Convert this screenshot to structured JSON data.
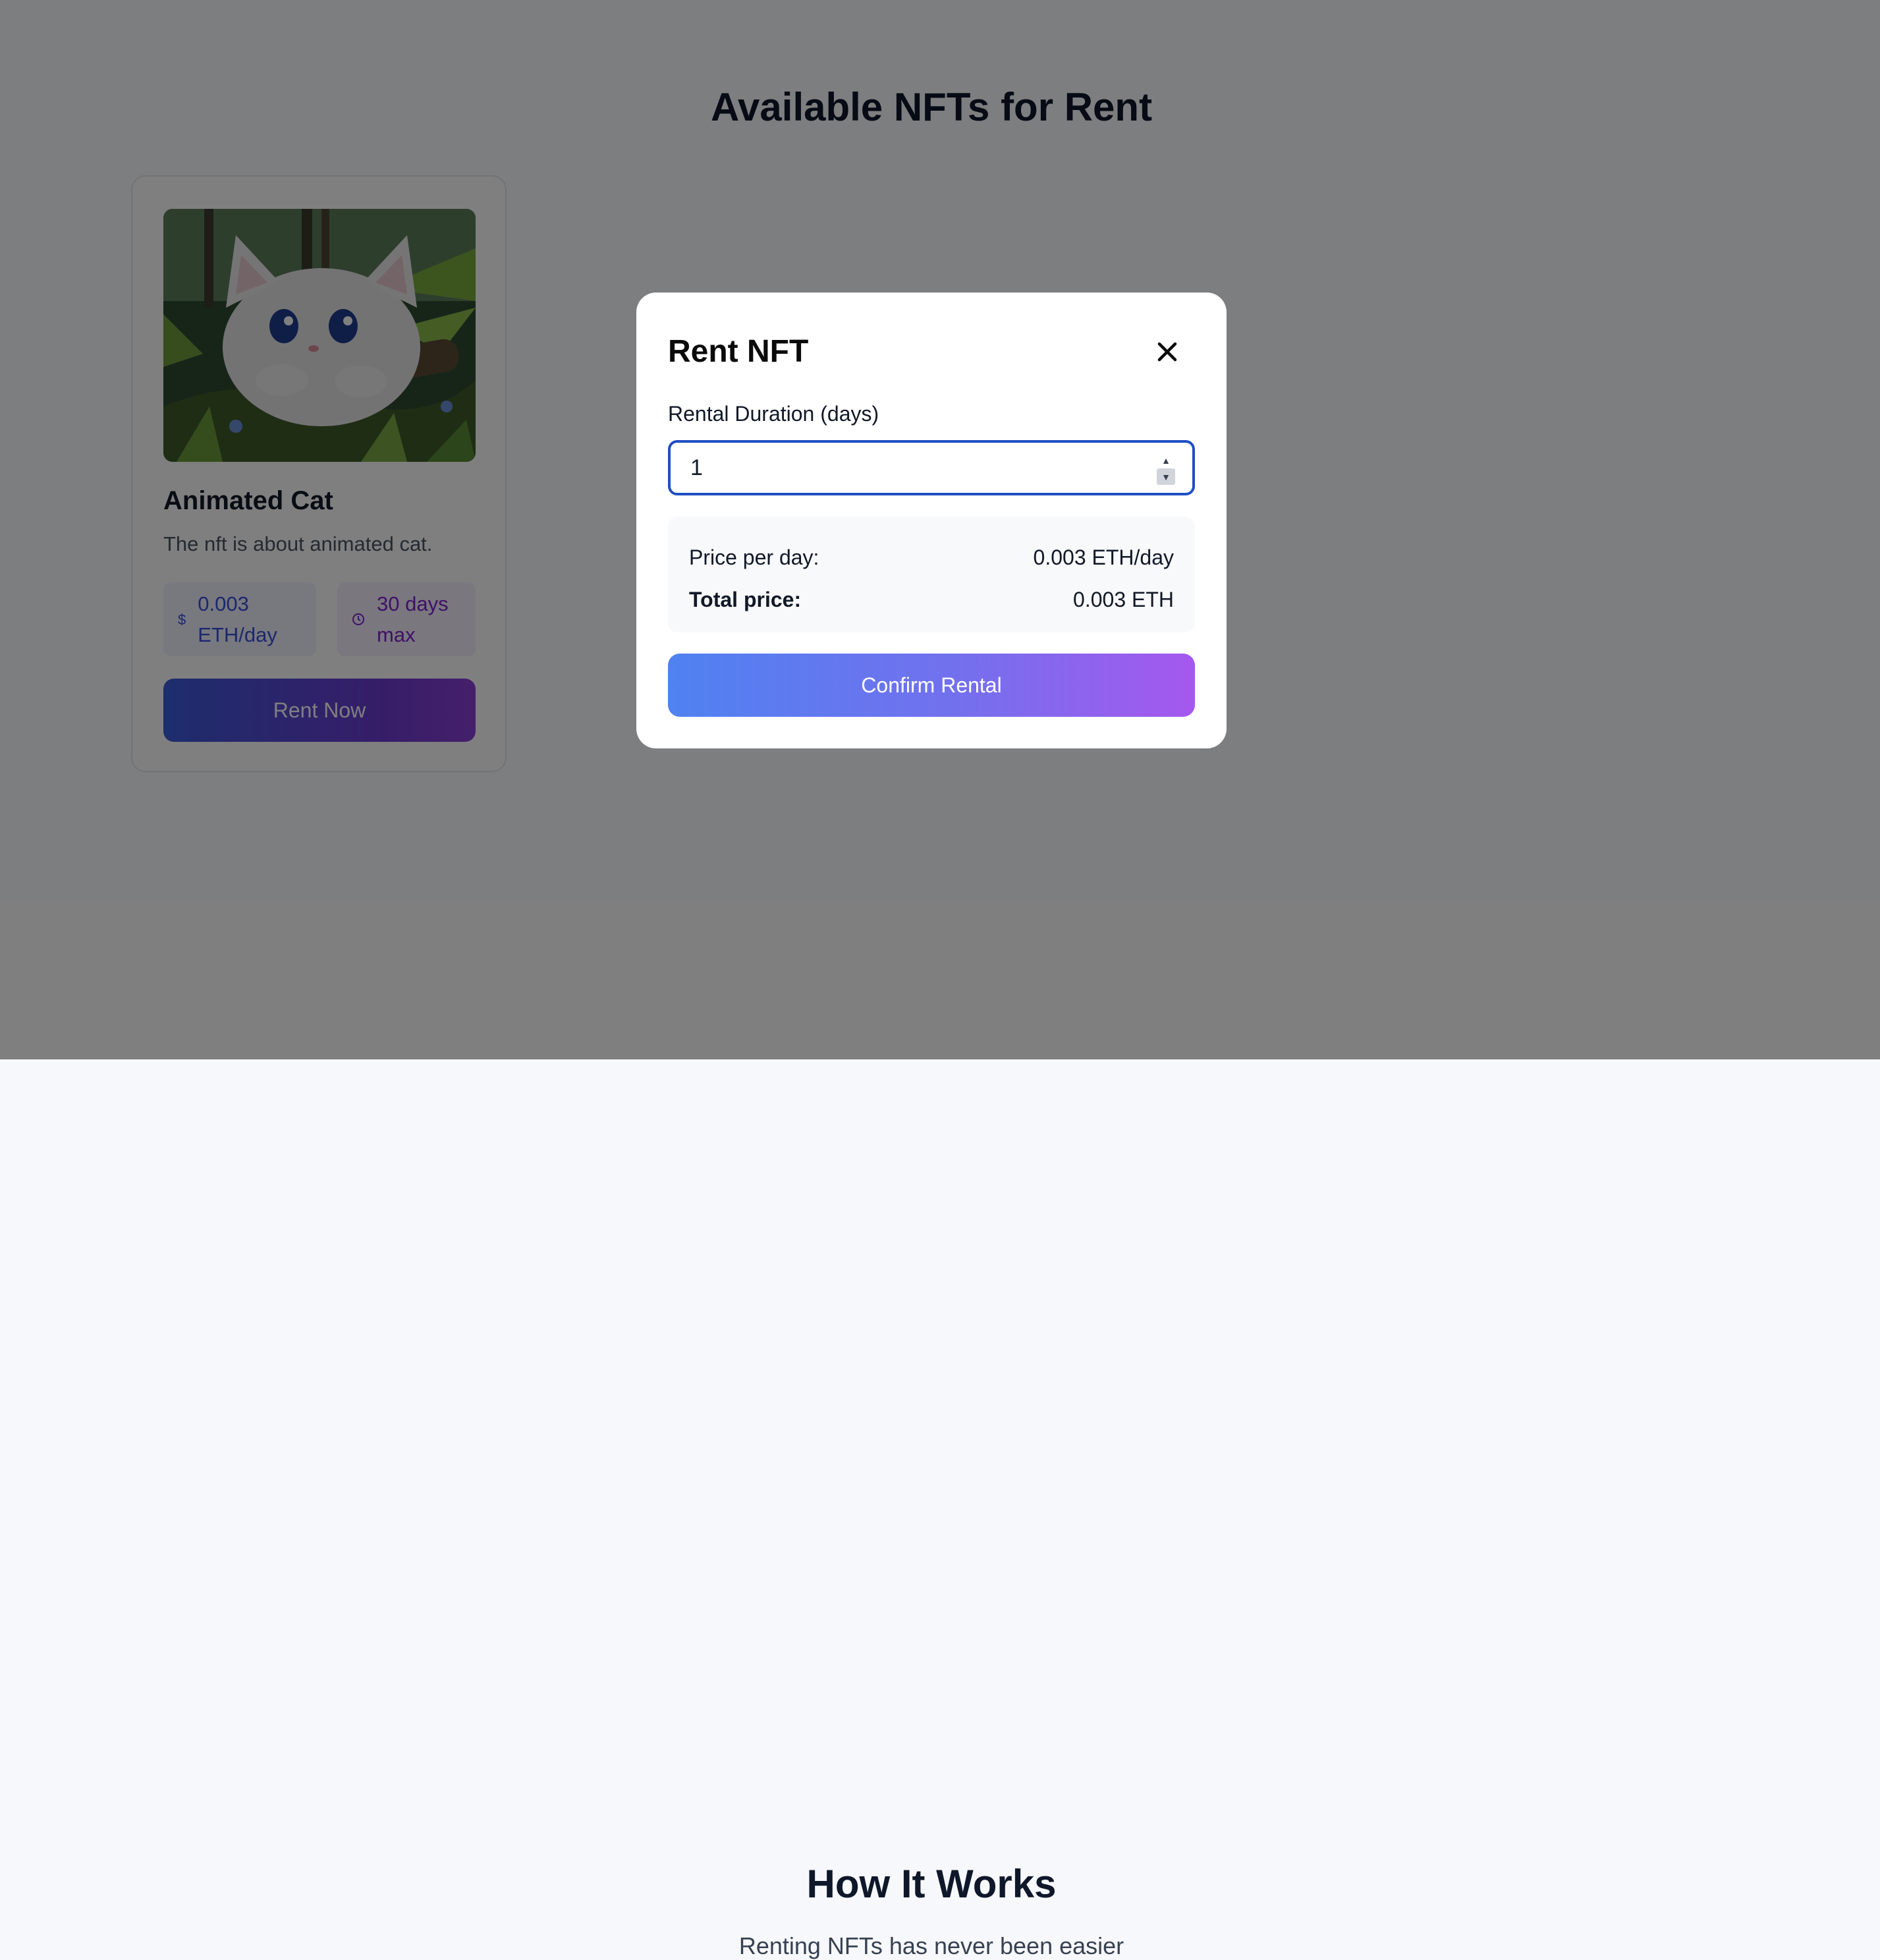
{
  "page": {
    "title": "Available NFTs for Rent"
  },
  "nft_card": {
    "name": "Animated Cat",
    "description": "The nft is about animated cat.",
    "price_icon": "dollar-icon",
    "price_line1": "0.003",
    "price_line2": "ETH/day",
    "days_icon": "clock-icon",
    "days_line1": "30 days",
    "days_line2": "max",
    "button_label": "Rent Now"
  },
  "how_it_works": {
    "title": "How It Works",
    "subtitle": "Renting NFTs has never been easier"
  },
  "modal": {
    "title": "Rent NFT",
    "close_icon": "close-icon",
    "duration_label": "Rental Duration (days)",
    "duration_value": "1",
    "price_per_day_label": "Price per day:",
    "price_per_day_value": "0.003 ETH/day",
    "total_price_label": "Total price:",
    "total_price_value": "0.003 ETH",
    "confirm_label": "Confirm Rental"
  },
  "colors": {
    "input_border": "#1e4fc2",
    "gradient_start": "#4f82f0",
    "gradient_end": "#a558ee",
    "overlay": "rgba(0,0,0,0.5)"
  }
}
